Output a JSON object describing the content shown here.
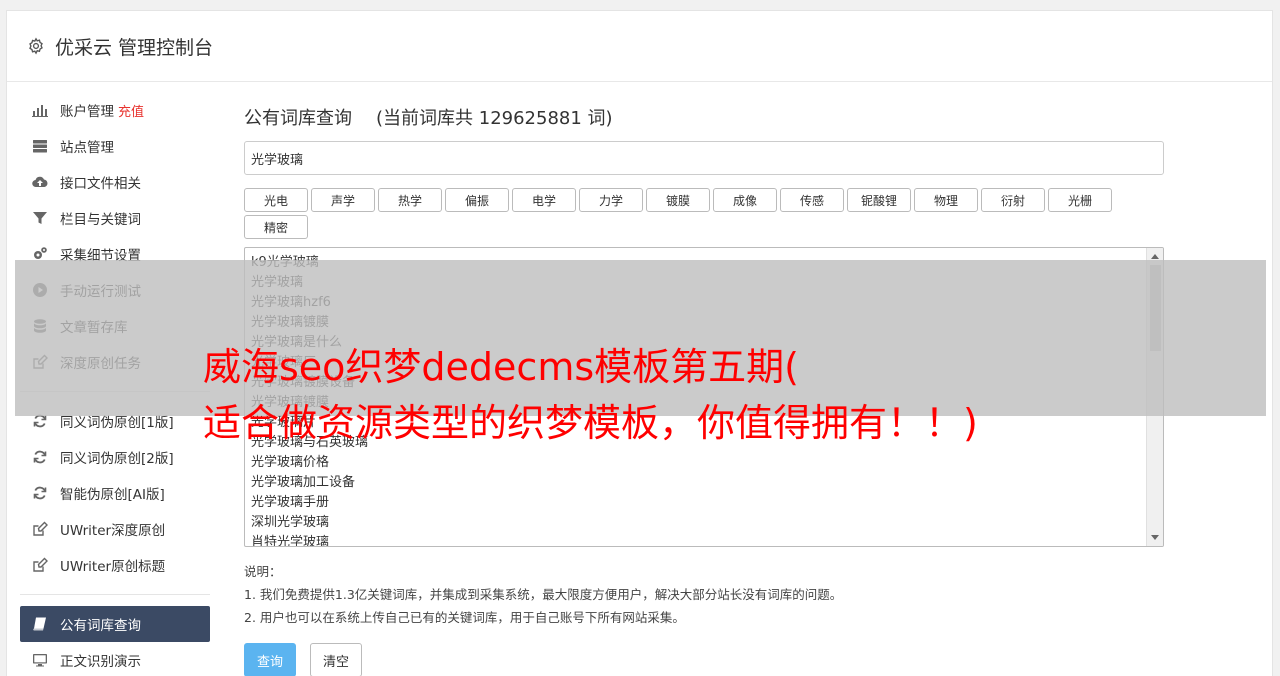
{
  "header": {
    "title": "优采云 管理控制台"
  },
  "sidebar": {
    "groups": [
      [
        {
          "label": "账户管理",
          "accent": "充值",
          "icon": "bar-chart-icon"
        },
        {
          "label": "站点管理",
          "icon": "server-icon"
        },
        {
          "label": "接口文件相关",
          "icon": "cloud-upload-icon"
        },
        {
          "label": "栏目与关键词",
          "icon": "filter-icon"
        },
        {
          "label": "采集细节设置",
          "icon": "gears-icon"
        },
        {
          "label": "手动运行测试",
          "icon": "play-circle-icon"
        },
        {
          "label": "文章暂存库",
          "icon": "database-icon"
        },
        {
          "label": "深度原创任务",
          "icon": "edit-icon"
        }
      ],
      [
        {
          "label": "同义词伪原创[1版]",
          "icon": "refresh-icon"
        },
        {
          "label": "同义词伪原创[2版]",
          "icon": "refresh-icon"
        },
        {
          "label": "智能伪原创[AI版]",
          "icon": "refresh-icon"
        },
        {
          "label": "UWriter深度原创",
          "icon": "edit-icon"
        },
        {
          "label": "UWriter原创标题",
          "icon": "edit-icon"
        }
      ],
      [
        {
          "label": "公有词库查询",
          "icon": "book-icon",
          "active": true
        },
        {
          "label": "正文识别演示",
          "icon": "monitor-icon"
        }
      ]
    ]
  },
  "main": {
    "title": "公有词库查询",
    "count_text": "(当前词库共 129625881 词)",
    "search_value": "光学玻璃",
    "chips": [
      "光电",
      "声学",
      "热学",
      "偏振",
      "电学",
      "力学",
      "镀膜",
      "成像",
      "传感",
      "铌酸锂",
      "物理",
      "衍射",
      "光栅",
      "精密"
    ],
    "results": [
      "k9光学玻璃",
      "光学玻璃",
      "光学玻璃hzf6",
      "光学玻璃镀膜",
      "光学玻璃是什么",
      "光学玻璃厂",
      "光学玻璃镀膜设备",
      "光学玻璃镀膜",
      "光学玻璃片",
      "光学玻璃与石英玻璃",
      "光学玻璃价格",
      "光学玻璃加工设备",
      "光学玻璃手册",
      "深圳光学玻璃",
      "肖特光学玻璃"
    ],
    "notes_title": "说明：",
    "notes": [
      "1. 我们免费提供1.3亿关键词库，并集成到采集系统，最大限度方便用户，解决大部分站长没有词库的问题。",
      "2. 用户也可以在系统上传自己已有的关键词库，用于自己账号下所有网站采集。"
    ],
    "query_label": "查询",
    "clear_label": "清空"
  },
  "banner": {
    "line1": "威海seo织梦dedecms模板第五期(",
    "line2": "适合做资源类型的织梦模板，你值得拥有！！)"
  }
}
